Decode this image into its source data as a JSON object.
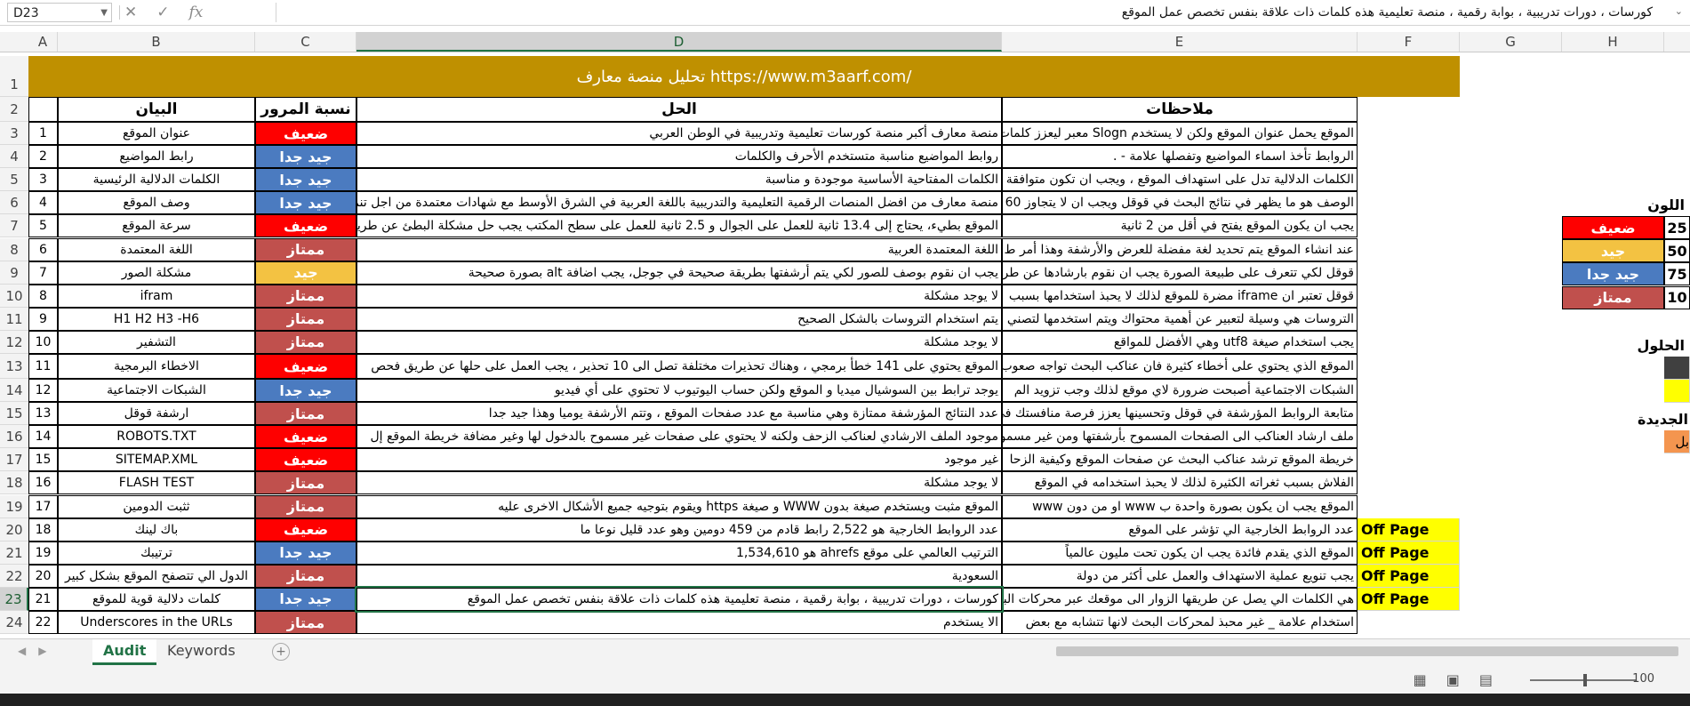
{
  "formula_bar": {
    "namebox": "D23",
    "content": "كورسات ، دورات تدريبية ، بوابة رقمية ، منصة تعليمية هذه كلمات ذات علاقة بنفس تخصص عمل الموقع"
  },
  "columns": [
    "A",
    "B",
    "C",
    "D",
    "E",
    "F",
    "G",
    "H"
  ],
  "title": "تحليل منصة معارف https://www.m3aarf.com/",
  "headers": {
    "b": "البيان",
    "c": "نسبة المرور",
    "d": "الحل",
    "e": "ملاحظات"
  },
  "rows": [
    {
      "n": "3",
      "a": "1",
      "b": "عنوان الموقع",
      "c": "ضعيف",
      "cls": "r-weak",
      "d": "منصة معارف أكبر منصة كورسات تعليمية وتدريبية في الوطن العربي",
      "e": "الموقع يحمل عنوان الموقع ولكن لا يستخدم Slogn معبر ليعزز كلمات"
    },
    {
      "n": "4",
      "a": "2",
      "b": "رابط المواضيع",
      "c": "جيد جدا",
      "cls": "r-vgood",
      "d": "روابط المواضيع مناسبة متستخدم الأحرف والكلمات",
      "e": "الروابط تأخذ اسماء المواضيع وتفصلها علامة - ."
    },
    {
      "n": "5",
      "a": "3",
      "b": "الكلمات الدلالية الرئيسية",
      "c": "جيد جدا",
      "cls": "r-vgood",
      "d": "الكلمات المفتاحية الأساسية موجودة و مناسبة",
      "e": "الكلمات الدلالية تدل على استهداف الموقع ، ويجب ان تكون متوافقة"
    },
    {
      "n": "6",
      "a": "4",
      "b": "وصف الموقع",
      "c": "جيد جدا",
      "cls": "r-vgood",
      "d": "منصة معارف من افضل المنصات الرقمية  التعليمية والتدريبية باللغة العربية في الشرق الأوسط  مع شهادات معتمدة من اجل تنمية",
      "e": "الوصف هو ما يظهر في نتائج البحث في قوقل ويجب ان لا يتجاوز 60"
    },
    {
      "n": "7",
      "a": "5",
      "b": "سرعة الموقع",
      "c": "ضعيف",
      "cls": "r-weak",
      "d": "الموقع بطيء، يحتاج إلى 13.4 ثانية للعمل على الجوال و 2.5 ثانية للعمل على سطح المكتب يجب حل مشكلة البطئ عن طريق",
      "e": "يجب ان يكون الموقع يفتح في أقل من 2 ثانية"
    },
    {
      "n": "8",
      "a": "6",
      "b": "اللغة المعتمدة",
      "c": "ممتاز",
      "cls": "r-exc",
      "d": "اللغة المعتمدة العربية",
      "e": "عند انشاء الموقع يتم تحديد لغة مفضلة للعرض والأرشفة وهذا أمر ط"
    },
    {
      "n": "9",
      "a": "7",
      "b": "مشكلة الصور",
      "c": "جيد",
      "cls": "r-good",
      "d": "يجب ان نقوم بوصف للصور لكي يتم أرشفتها بطريقة صحيحة في جوجل، يجب اضافة alt بصورة صحيحة",
      "e": "قوقل لكي تتعرف على طبيعة الصورة يجب ان نقوم بارشادها عن طريق"
    },
    {
      "n": "10",
      "a": "8",
      "b": "ifram",
      "c": "ممتاز",
      "cls": "r-exc",
      "d": "لا يوجد مشكلة",
      "e": "قوقل تعتبر ان iframe مضرة للموقع لذلك لا يحبذ استخدامها بسبب"
    },
    {
      "n": "11",
      "a": "9",
      "b": "H1 H2 H3 -H6",
      "c": "ممتاز",
      "cls": "r-exc",
      "d": "يتم استخدام التروسات بالشكل الصحيح",
      "e": "التروسات هي وسيلة لتعبير عن أهمية محتواك ويتم استخدمها لتصني"
    },
    {
      "n": "12",
      "a": "10",
      "b": "التشفير",
      "c": "ممتاز",
      "cls": "r-exc",
      "d": "لا يوجد مشكلة",
      "e": "يجب استخدام صيغة utf8 وهي الأفضل للمواقع"
    },
    {
      "n": "13",
      "a": "11",
      "b": "الاخطاء البرمجية",
      "c": "ضعيف",
      "cls": "r-weak",
      "d": "الموقع يحتوي على 141 خطأ برمجي ، وهناك تحذيرات مختلفة تصل الى 10 تحذير ، يجب العمل على حلها عن طريق فحص",
      "e": "الموقع الذي يحتوي على أخطاء كثيرة فان عناكب البحث تواجه صعوب"
    },
    {
      "n": "14",
      "a": "12",
      "b": "الشبكات الاجتماعية",
      "c": "جيد جدا",
      "cls": "r-vgood",
      "d": "يوجد ترابط بين السوشيال ميديا و الموقع ولكن حساب اليوتيوب لا تحتوي على أي فيديو",
      "e": "الشبكات الاجتماعية أصبحت ضرورة لاي موقع لذلك وجب تزويد الم"
    },
    {
      "n": "15",
      "a": "13",
      "b": "ارشفة قوقل",
      "c": "ممتاز",
      "cls": "r-exc",
      "d": "عدد النتائج المؤرشفة ممتازة وهي مناسبة مع عدد صفحات الموقع ، وتتم الأرشفة يوميا وهذا جيد جدا",
      "e": "متابعة الروابط المؤرشفة في قوقل وتحسينها يعزز فرصة منافستك في"
    },
    {
      "n": "16",
      "a": "14",
      "b": "ROBOTS.TXT",
      "c": "ضعيف",
      "cls": "r-weak",
      "d": "موجود الملف الارشادي لعناكب الزحف ولكنه لا يحتوي على صفحات غير مسموح بالدخول لها وغير مضافة خريطة الموقع إل",
      "e": "ملف ارشاد العناكب الى الصفحات المسموح بأرشفتها ومن غير مسموح"
    },
    {
      "n": "17",
      "a": "15",
      "b": "SITEMAP.XML",
      "c": "ضعيف",
      "cls": "r-weak",
      "d": "غير موجود",
      "e": "خريطة الموقع ترشد عناكب البحث عن صفحات الموقع وكيفية الزحا"
    },
    {
      "n": "18",
      "a": "16",
      "b": "FLASH TEST",
      "c": "ممتاز",
      "cls": "r-exc",
      "d": "لا يوجد مشكلة",
      "e": "الفلاش بسبب ثغراته الكثيرة لذلك لا يحبذ استخدامه في الموقع"
    },
    {
      "n": "19",
      "a": "17",
      "b": "ثثبت الدومين",
      "c": "ممتاز",
      "cls": "r-exc",
      "d": "الموقع مثبت ويستخدم صيغة بدون WWW و صيغة https ويقوم بتوجيه جميع الأشكال الاخرى عليه",
      "e": "الموقع يجب ان يكون بصورة واحدة ب www او من دون www"
    },
    {
      "n": "20",
      "a": "18",
      "b": "باك لينك",
      "c": "ضعيف",
      "cls": "r-weak",
      "d": "عدد الروابط الخارجية هو 2,522 رابط  قادم من 459 دومين وهو عدد قليل نوعا ما",
      "e": "عدد الروابط الخارجية الي تؤشر على الموقع",
      "f": "Off Page"
    },
    {
      "n": "21",
      "a": "19",
      "b": "ترتيبك",
      "c": "جيد جدا",
      "cls": "r-vgood",
      "d": "الترتيب العالمي على موقع ahrefs هو 1,534,610",
      "e": "الموقع الذي يقدم فائدة يجب ان يكون تحت مليون عالمياً",
      "f": "Off Page"
    },
    {
      "n": "22",
      "a": "20",
      "b": "الدول الي تتصفح الموقع بشكل كبير",
      "c": "ممتاز",
      "cls": "r-exc",
      "d": "السعودية",
      "e": "يجب تنويع عملية الاستهداف والعمل على أكثر من دولة",
      "f": "Off Page"
    },
    {
      "n": "23",
      "a": "21",
      "b": "كلمات دلالية قوية للموقع",
      "c": "جيد جدا",
      "cls": "r-vgood",
      "d": "كورسات ، دورات تدريبية ، بوابة رقمية ، منصة تعليمية هذه كلمات ذات علاقة بنفس تخصص عمل الموقع",
      "e": "هي الكلمات الي يصل عن طريقها الزوار الى موقعك عبر محركات البحث",
      "f": "Off Page"
    },
    {
      "n": "24",
      "a": "22",
      "b": "Underscores in the URLs",
      "c": "ممتاز",
      "cls": "r-exc",
      "d": "الا يستخدم",
      "e": "استخدام علامة _ غير محبذ لمحركات البحث لانها تتشابه مع بعض"
    }
  ],
  "legend": {
    "title": "اللون",
    "items": [
      {
        "value": "25",
        "label": "ضعيف",
        "color": "#fe0000"
      },
      {
        "value": "50",
        "label": "جيد",
        "color": "#f3c242"
      },
      {
        "value": "75",
        "label": "جيد جدا",
        "color": "#4b7bc0"
      },
      {
        "value": "10",
        "label": "ممتاز",
        "color": "#c0504d"
      }
    ],
    "solutions_label": "الحلول",
    "new_label": "الجديدة",
    "partial_label": "بل"
  },
  "sheet_tabs": [
    "Audit",
    "Keywords"
  ],
  "active_tab": "Audit",
  "zoom": "100"
}
